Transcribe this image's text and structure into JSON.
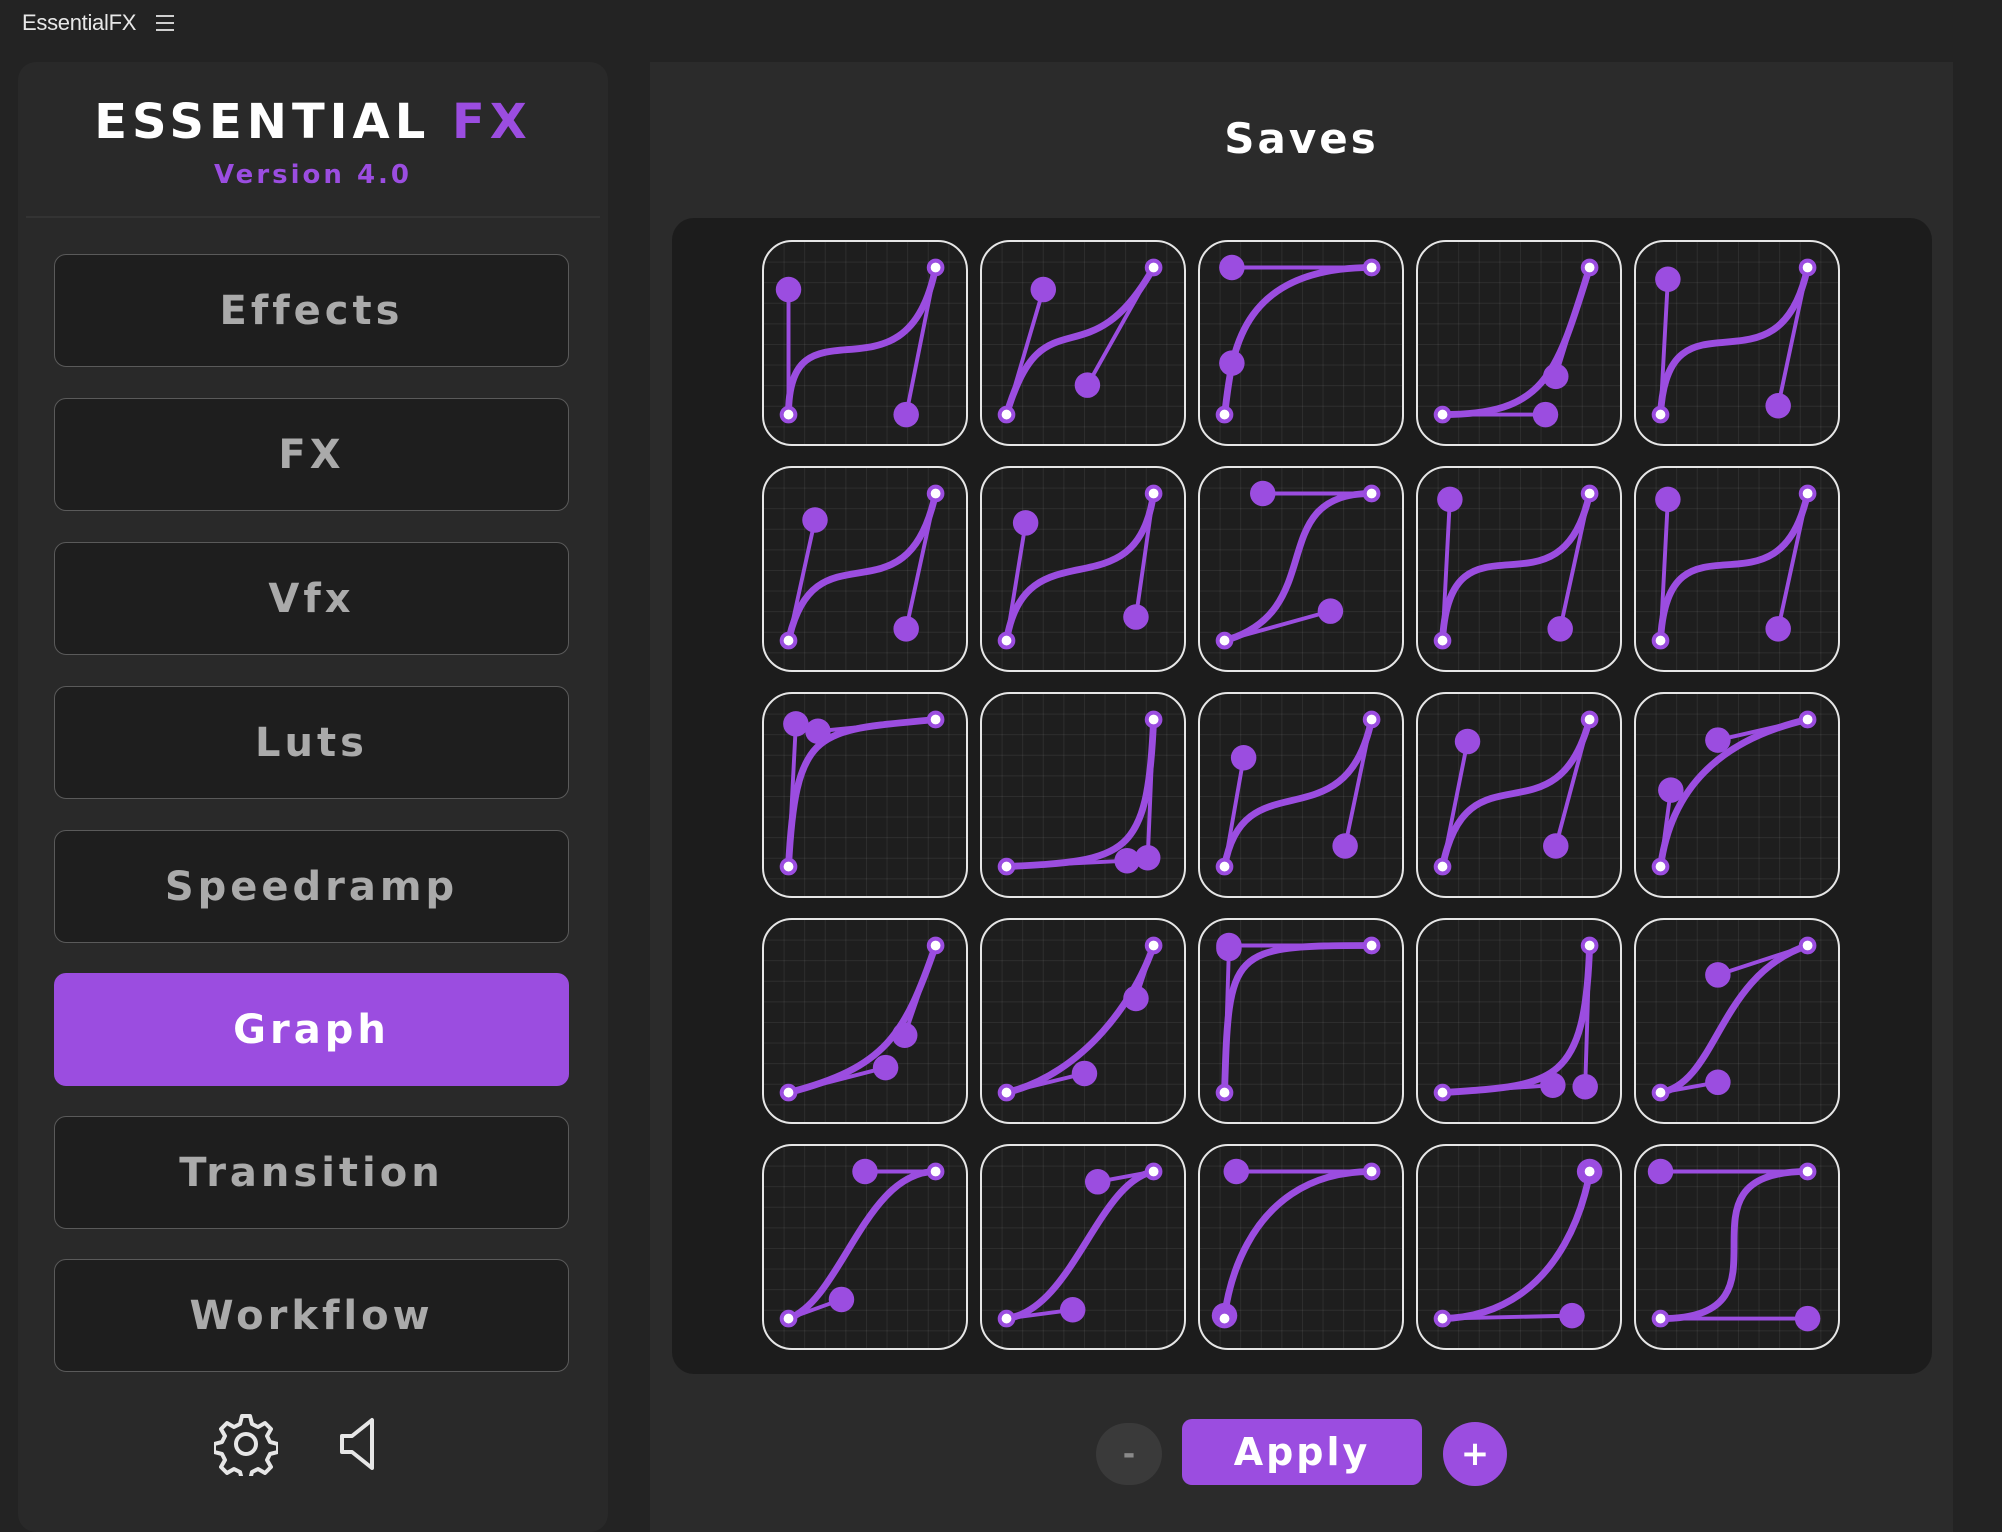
{
  "window": {
    "title": "EssentialFX"
  },
  "brand": {
    "title_main": "ESSENTIAL",
    "title_accent": "FX",
    "version": "Version 4.0"
  },
  "nav": {
    "items": [
      {
        "label": "Effects",
        "active": false
      },
      {
        "label": "FX",
        "active": false
      },
      {
        "label": "Vfx",
        "active": false
      },
      {
        "label": "Luts",
        "active": false
      },
      {
        "label": "Speedramp",
        "active": false
      },
      {
        "label": "Graph",
        "active": true
      },
      {
        "label": "Transition",
        "active": false
      },
      {
        "label": "Workflow",
        "active": false
      }
    ]
  },
  "tools": {
    "settings_icon": "gear-icon",
    "sound_icon": "speaker-icon"
  },
  "main": {
    "title": "Saves"
  },
  "colors": {
    "accent": "#9b4de0",
    "background": "#232323",
    "panel": "#2b2b2b",
    "grid_bg": "#1c1c1c",
    "tile_border": "#e6e6e6"
  },
  "saves": [
    {
      "h1": [
        0.0,
        0.85
      ],
      "h2": [
        0.8,
        0.0
      ]
    },
    {
      "h1": [
        0.25,
        0.85
      ],
      "h2": [
        0.55,
        0.2
      ]
    },
    {
      "h1": [
        0.05,
        0.35
      ],
      "h2": [
        0.05,
        1.0
      ]
    },
    {
      "h1": [
        0.7,
        0.0
      ],
      "h2": [
        0.77,
        0.26
      ]
    },
    {
      "h1": [
        0.05,
        0.92
      ],
      "h2": [
        0.8,
        0.06
      ]
    },
    {
      "h1": [
        0.18,
        0.82
      ],
      "h2": [
        0.8,
        0.08
      ]
    },
    {
      "h1": [
        0.13,
        0.8
      ],
      "h2": [
        0.88,
        0.16
      ]
    },
    {
      "h1": [
        0.72,
        0.2
      ],
      "h2": [
        0.26,
        1.0
      ]
    },
    {
      "h1": [
        0.05,
        0.96
      ],
      "h2": [
        0.8,
        0.08
      ]
    },
    {
      "h1": [
        0.05,
        0.96
      ],
      "h2": [
        0.8,
        0.08
      ]
    },
    {
      "h1": [
        0.05,
        0.97
      ],
      "h2": [
        0.2,
        0.92
      ]
    },
    {
      "h1": [
        0.82,
        0.04
      ],
      "h2": [
        0.96,
        0.06
      ]
    },
    {
      "h1": [
        0.13,
        0.74
      ],
      "h2": [
        0.82,
        0.14
      ]
    },
    {
      "h1": [
        0.17,
        0.85
      ],
      "h2": [
        0.77,
        0.14
      ]
    },
    {
      "h1": [
        0.07,
        0.52
      ],
      "h2": [
        0.39,
        0.86
      ]
    },
    {
      "h1": [
        0.66,
        0.17
      ],
      "h2": [
        0.79,
        0.39
      ]
    },
    {
      "h1": [
        0.53,
        0.13
      ],
      "h2": [
        0.88,
        0.64
      ]
    },
    {
      "h1": [
        0.03,
        0.98
      ],
      "h2": [
        0.03,
        1.0
      ]
    },
    {
      "h1": [
        0.75,
        0.05
      ],
      "h2": [
        0.97,
        0.04
      ]
    },
    {
      "h1": [
        0.39,
        0.07
      ],
      "h2": [
        0.39,
        0.8
      ]
    },
    {
      "h1": [
        0.36,
        0.13
      ],
      "h2": [
        0.52,
        1.0
      ]
    },
    {
      "h1": [
        0.45,
        0.06
      ],
      "h2": [
        0.62,
        0.93
      ]
    },
    {
      "h1": [
        0.0,
        0.02
      ],
      "h2": [
        0.08,
        1.0
      ]
    },
    {
      "h1": [
        0.88,
        0.02
      ],
      "h2": [
        1.0,
        1.0
      ]
    },
    {
      "h1": [
        1.0,
        0.0
      ],
      "h2": [
        0.0,
        1.0
      ]
    }
  ]
}
